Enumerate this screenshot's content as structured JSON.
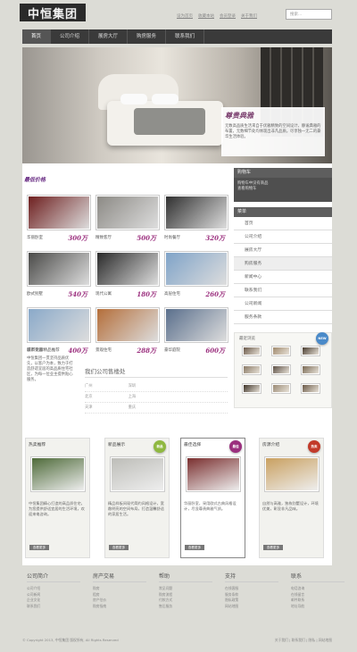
{
  "header": {
    "logo": "中恒集团",
    "links": [
      "设为首页",
      "收藏本站",
      "会员登录",
      "关于我们"
    ],
    "search_placeholder": "搜索..."
  },
  "nav": [
    "首页",
    "公司介绍",
    "展房大厅",
    "购房服务",
    "联系我们"
  ],
  "hero": {
    "title": "尊贵典雅",
    "desc": "无数高品质生活来自于优雅精致的空间设计，静谧典雅的布置，无数细节处均体现出非凡品质。尽享独一无二的豪华生活体验。"
  },
  "special": {
    "title": "最低价格",
    "items": [
      {
        "name": "华丽卧室",
        "price": "300万",
        "c": "#6e1f1f"
      },
      {
        "name": "精致客厅",
        "price": "500万",
        "c": "#8c8a85"
      },
      {
        "name": "时尚餐厅",
        "price": "320万",
        "c": "#303030"
      },
      {
        "name": "欧式别墅",
        "price": "540万",
        "c": "#4a4a48"
      },
      {
        "name": "现代公寓",
        "price": "180万",
        "c": "#2a2a2a"
      },
      {
        "name": "高层住宅",
        "price": "260万",
        "c": "#7fa3c8"
      },
      {
        "name": "城市花园",
        "price": "400万",
        "c": "#8aa9c9"
      },
      {
        "name": "景观住宅",
        "price": "288万",
        "c": "#b46e3a"
      },
      {
        "name": "豪华庭院",
        "price": "600万",
        "c": "#5a6f8c"
      }
    ]
  },
  "blurb": {
    "title": "最新文章精品推荐",
    "text": "中恒集团一贯坚持品质优先，以客户为本，致力于打造舒适宜居的高品质住宅社区，为每一位业主提供贴心服务。"
  },
  "sales": {
    "title": "我们公司售楼处",
    "rows": [
      [
        "广州",
        "深圳"
      ],
      [
        "北京",
        "上海"
      ],
      [
        "天津",
        "重庆"
      ]
    ]
  },
  "sidebar": {
    "cart_title": "购物车",
    "cart_text": "购物车中没有商品\n查看购物车",
    "menu_title": "菜单",
    "menu": [
      "首页",
      "公司介绍",
      "展房大厅",
      "购房服务",
      "新闻中心",
      "联系我们",
      "公司新闻",
      "服务条款"
    ],
    "active": 3,
    "recent_title": "最近浏览"
  },
  "thumb_colors": [
    "#6b5a4a",
    "#a08a6e",
    "#4a3d30",
    "#8a7a66",
    "#5d5045",
    "#7a6a55",
    "#3e3328",
    "#9a8a75",
    "#6b5a48"
  ],
  "cards": [
    {
      "title": "热卖推荐",
      "badge": "",
      "badge_color": "",
      "img": "#4f6b3a",
      "text": "中恒集团精心打造的高品质住宅，为您提供舒适宜居的生活环境，欢迎来电咨询。",
      "more": "查看更多"
    },
    {
      "title": "新品展示",
      "badge": "新品",
      "badge_color": "#8fb840",
      "img": "#bdbdb8",
      "text": "精品样板间现代简约风格设计，宽敞明亮的空间布局，打造温馨舒适的家居生活。",
      "more": "查看更多"
    },
    {
      "title": "最佳选择",
      "badge": "最佳",
      "badge_color": "#9b2f7e",
      "img": "#7a2f2f",
      "text": "华丽卧室，采用欧式古典风格设计，尽显尊贵典雅气质。",
      "more": "查看更多"
    },
    {
      "title": "房源介绍",
      "badge": "热卖",
      "badge_color": "#c23a2a",
      "img": "#c9a060",
      "text": "自然与高雅，独栋别墅设计，环境优美，彰显非凡品味。",
      "more": "查看更多"
    }
  ],
  "footer": {
    "cols": [
      {
        "h": "公司简介",
        "l": [
          "公司介绍",
          "公司新闻",
          "企业文化",
          "联系我们"
        ]
      },
      {
        "h": "房产交易",
        "l": [
          "购房",
          "租房",
          "房产估价",
          "购房指南"
        ]
      },
      {
        "h": "帮助",
        "l": [
          "常见问题",
          "购房流程",
          "付款方式",
          "售后服务"
        ]
      },
      {
        "h": "支持",
        "l": [
          "在线客服",
          "服务条款",
          "隐私政策",
          "网站地图"
        ]
      },
      {
        "h": "联系",
        "l": [
          "电话咨询",
          "在线留言",
          "邮件联系",
          "地址导航"
        ]
      }
    ],
    "copyright": "© Copyright 2013, 中恒集团 版权所有, All Rights Reserved",
    "bottom_links": [
      "关于我们",
      "联系我们",
      "隐私",
      "网站地图"
    ]
  }
}
